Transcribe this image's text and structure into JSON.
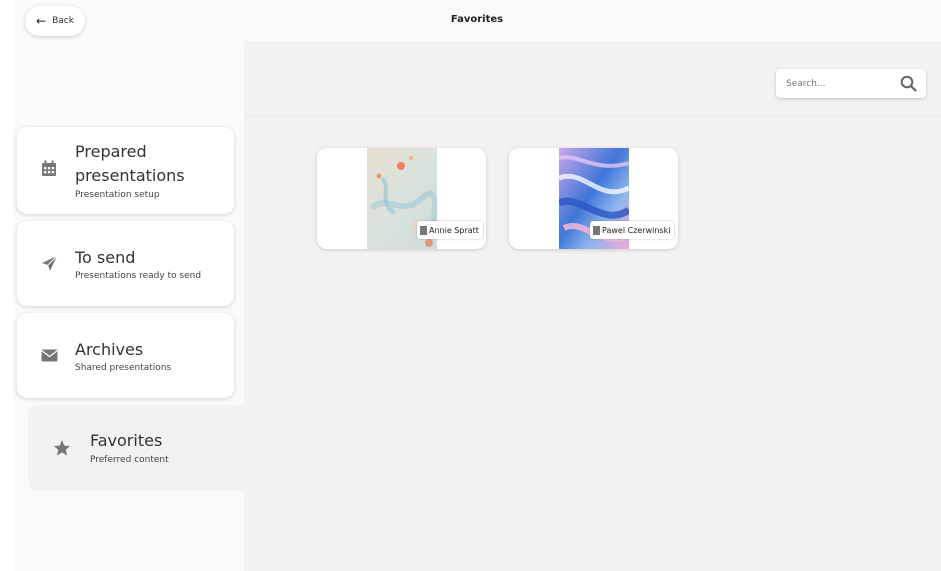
{
  "header": {
    "back_label": "Back",
    "title": "Favorites"
  },
  "sidebar": {
    "items": [
      {
        "title": "Prepared presentations",
        "subtitle": "Presentation setup",
        "icon": "calendar-icon",
        "active": false
      },
      {
        "title": "To send",
        "subtitle": "Presentations ready to send",
        "icon": "paper-plane-icon",
        "active": false
      },
      {
        "title": "Archives",
        "subtitle": "Shared presentations",
        "icon": "envelope-icon",
        "active": false
      },
      {
        "title": "Favorites",
        "subtitle": "Preferred content",
        "icon": "star-icon",
        "active": true
      }
    ]
  },
  "search": {
    "placeholder": "Search..."
  },
  "favorites": [
    {
      "author": "Annie Spratt",
      "icon": "document-icon"
    },
    {
      "author": "Pawel Czerwinski",
      "icon": "document-icon"
    }
  ],
  "colors": {
    "sidebar_bg": "#f8fafb",
    "content_bg": "#f3f1f1",
    "icon_gray": "#777777"
  }
}
